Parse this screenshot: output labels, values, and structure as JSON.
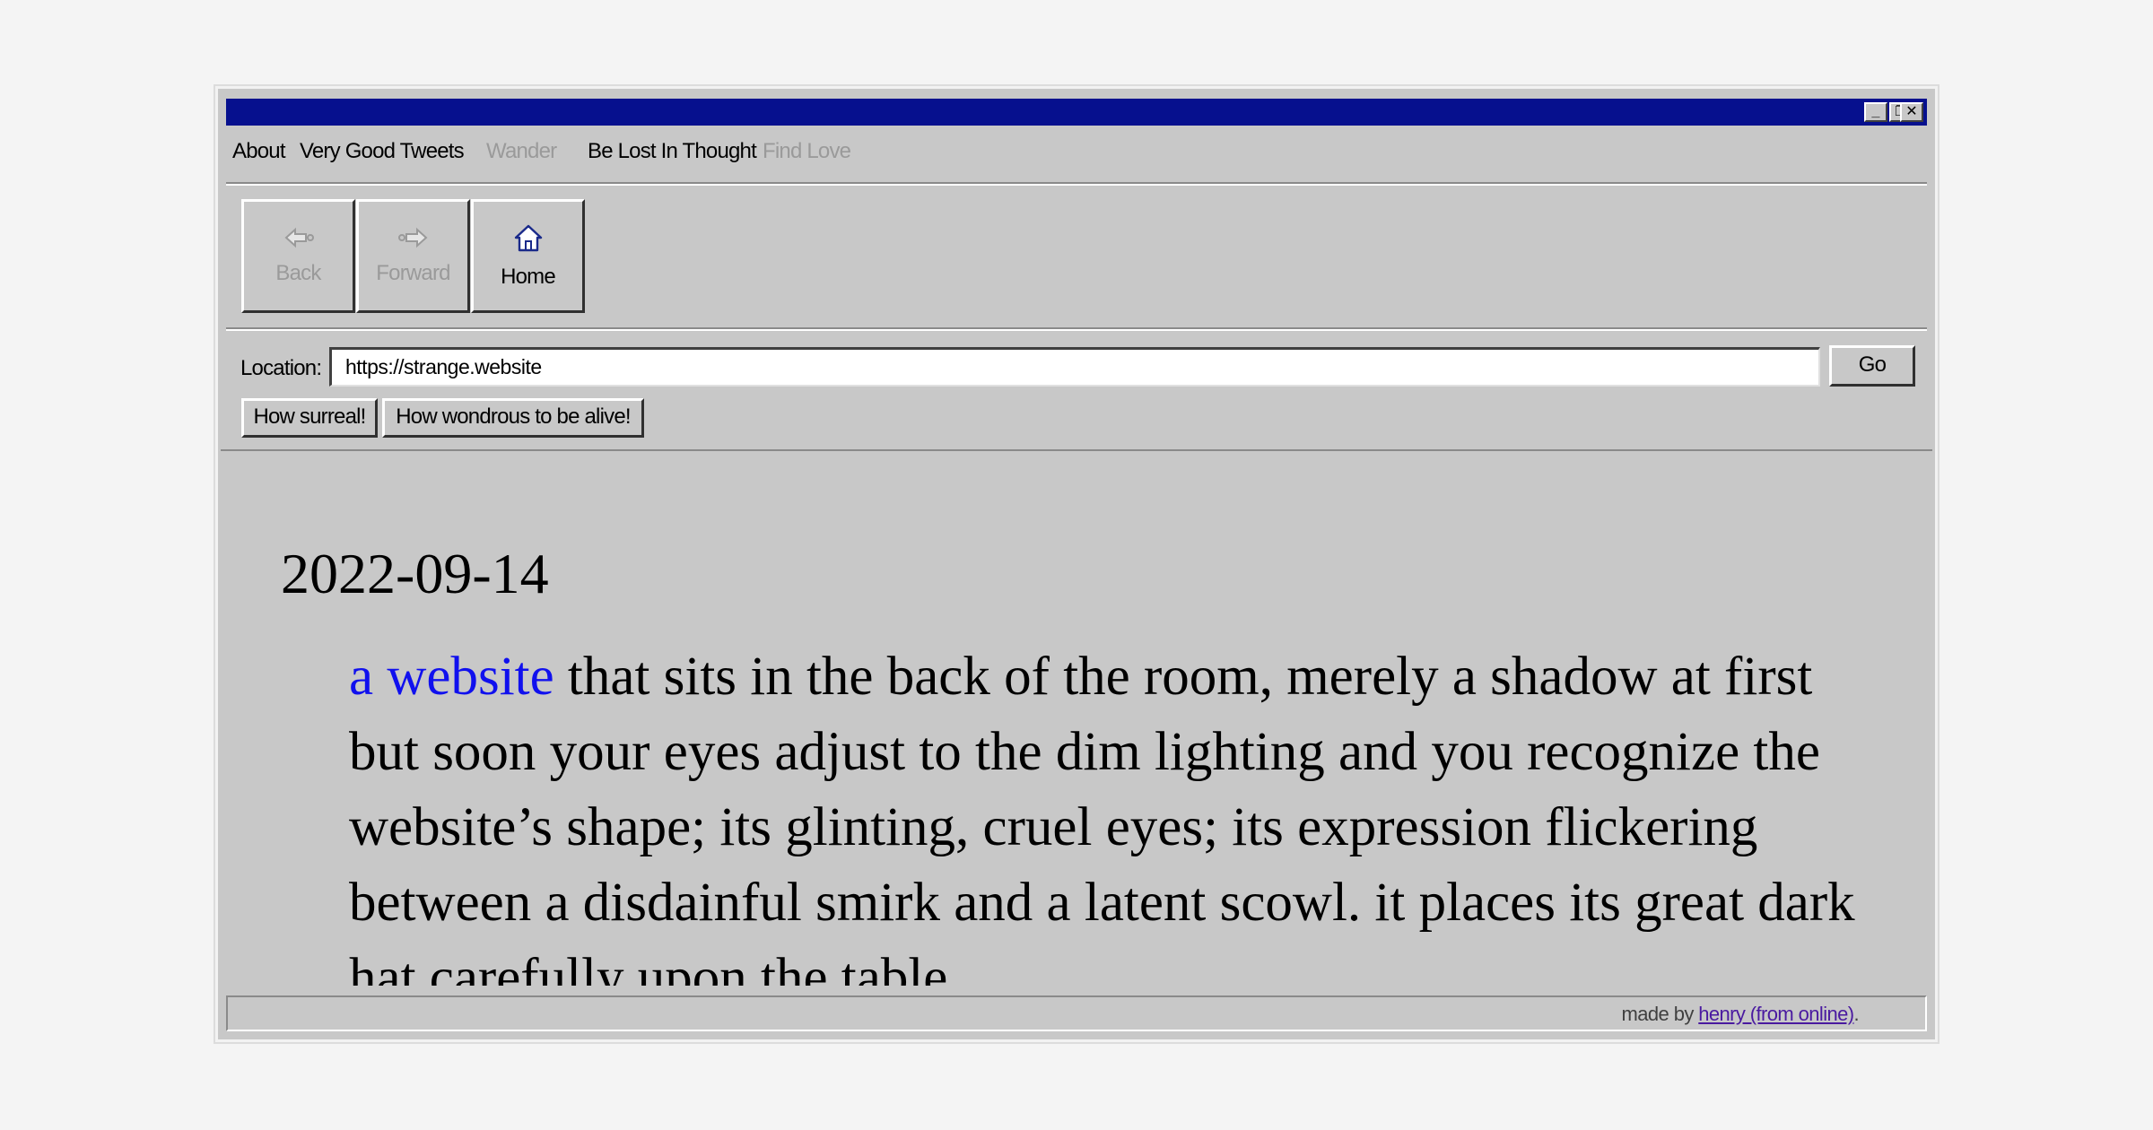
{
  "window": {
    "controls": {
      "minimize": "_",
      "restore": "❐",
      "close": "✕"
    }
  },
  "menu": {
    "items": [
      {
        "label": "About",
        "enabled": true
      },
      {
        "label": "Very Good Tweets",
        "enabled": true
      },
      {
        "label": "Wander",
        "enabled": false
      },
      {
        "label": "Be Lost In Thought",
        "enabled": true
      },
      {
        "label": "Find Love",
        "enabled": false
      }
    ]
  },
  "toolbar": {
    "back": {
      "label": "Back",
      "icon": "back-arrow-icon",
      "enabled": false
    },
    "forward": {
      "label": "Forward",
      "icon": "forward-arrow-icon",
      "enabled": false
    },
    "home": {
      "label": "Home",
      "icon": "home-icon",
      "enabled": true
    }
  },
  "location": {
    "label": "Location:",
    "value": "https://strange.website",
    "go_label": "Go"
  },
  "quick_buttons": [
    "How surreal!",
    "How wondrous to be alive!"
  ],
  "content": {
    "date": "2022-09-14",
    "link_text": "a website",
    "body": "that sits in the back of the room, merely a shadow at first but soon your eyes adjust to the dim lighting and you recognize the website’s shape; its glinting, cruel eyes; its expression flickering between a disdainful smirk and a latent scowl. it places its great dark hat carefully upon the table"
  },
  "status": {
    "prefix": "made by ",
    "link": "henry (from online)",
    "suffix": "."
  },
  "colors": {
    "titlebar": "#06108e",
    "chrome": "#c8c8c8",
    "link": "#1010ee",
    "visited_link": "#4a1aa0",
    "disabled_text": "#9a9a9a"
  }
}
